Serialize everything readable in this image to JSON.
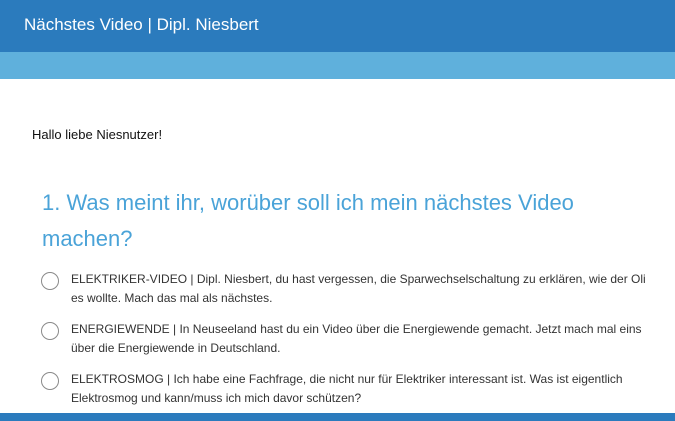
{
  "header": {
    "title": "Nächstes Video | Dipl. Niesbert"
  },
  "greeting": "Hallo liebe Niesnutzer!",
  "question": {
    "title": "1. Was meint ihr, worüber soll ich mein nächstes Video machen?",
    "options": [
      {
        "label": "ELEKTRIKER-VIDEO | Dipl. Niesbert, du hast vergessen, die Sparwechselschaltung zu erklären, wie der Oli es wollte. Mach das mal als nächstes.",
        "selected": false
      },
      {
        "label": "ENERGIEWENDE | In Neuseeland hast du ein Video über die Energiewende gemacht. Jetzt mach mal eins über die Energiewende in Deutschland.",
        "selected": false
      },
      {
        "label": "ELEKTROSMOG | Ich habe eine Fachfrage, die nicht nur für Elektriker interessant ist. Was ist eigentlich Elektrosmog und kann/muss ich mich davor schützen?",
        "selected": false
      }
    ]
  },
  "colors": {
    "header": "#2b7bbd",
    "subbar": "#5fb0dc",
    "question_title": "#4aa3d8"
  }
}
